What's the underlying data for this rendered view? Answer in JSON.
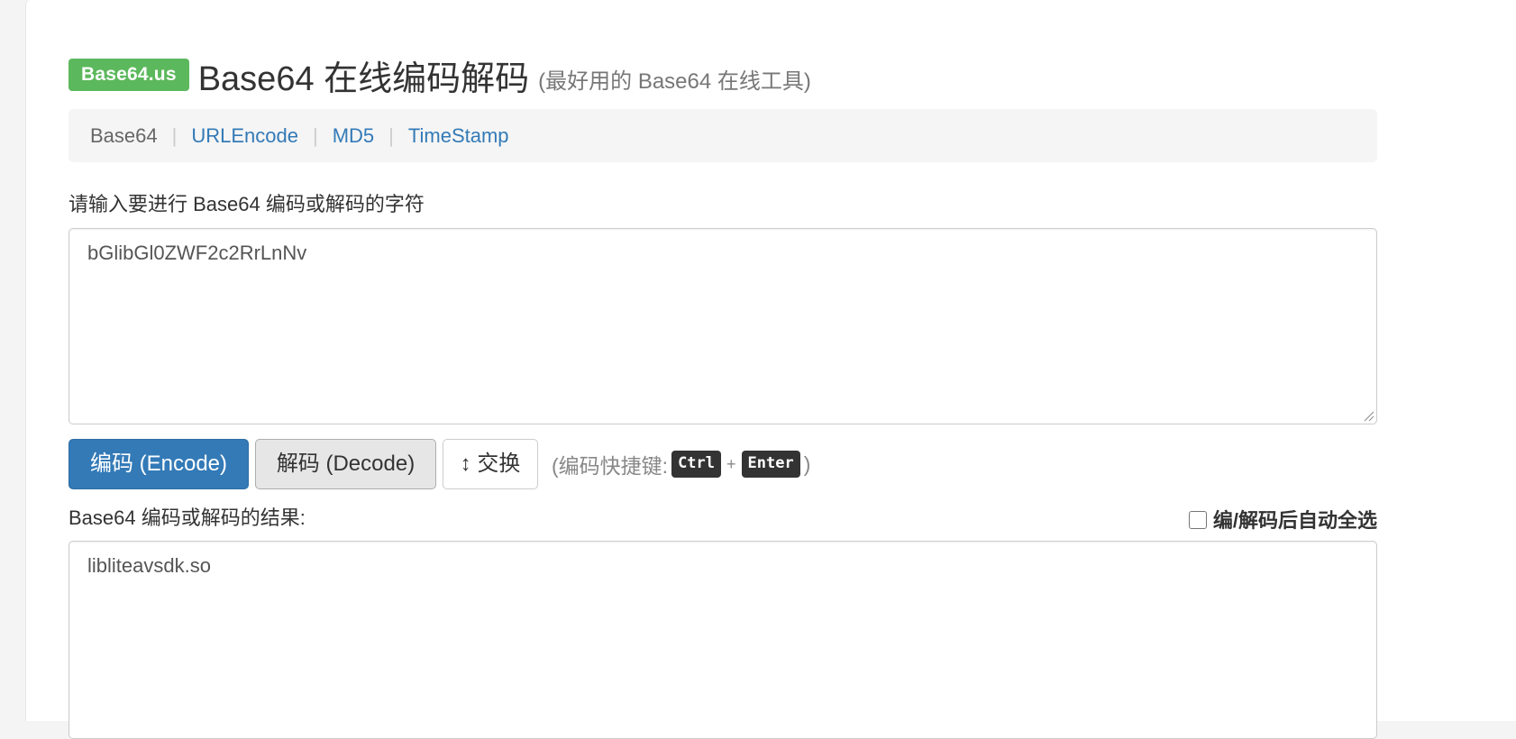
{
  "header": {
    "badge": "Base64.us",
    "title": "Base64 在线编码解码",
    "subtitle": "(最好用的 Base64 在线工具)"
  },
  "nav": {
    "items": [
      {
        "label": "Base64"
      },
      {
        "label": "URLEncode"
      },
      {
        "label": "MD5"
      },
      {
        "label": "TimeStamp"
      }
    ],
    "separator": "|"
  },
  "input": {
    "label": "请输入要进行 Base64 编码或解码的字符",
    "value": "bGlibGl0ZWF2c2RrLnNv"
  },
  "buttons": {
    "encode": "编码 (Encode)",
    "decode": "解码 (Decode)",
    "swap": "↕ 交换"
  },
  "shortcut": {
    "prefix": "(编码快捷键:",
    "key1": "Ctrl",
    "plus": "+",
    "key2": "Enter",
    "suffix": ")"
  },
  "output": {
    "label": "Base64 编码或解码的结果:",
    "autoselect_label": "编/解码后自动全选",
    "autoselect_checked": false,
    "value": "libliteavsdk.so"
  },
  "colors": {
    "badge": "#5cb85c",
    "primary": "#337ab7",
    "link": "#337ab7"
  }
}
